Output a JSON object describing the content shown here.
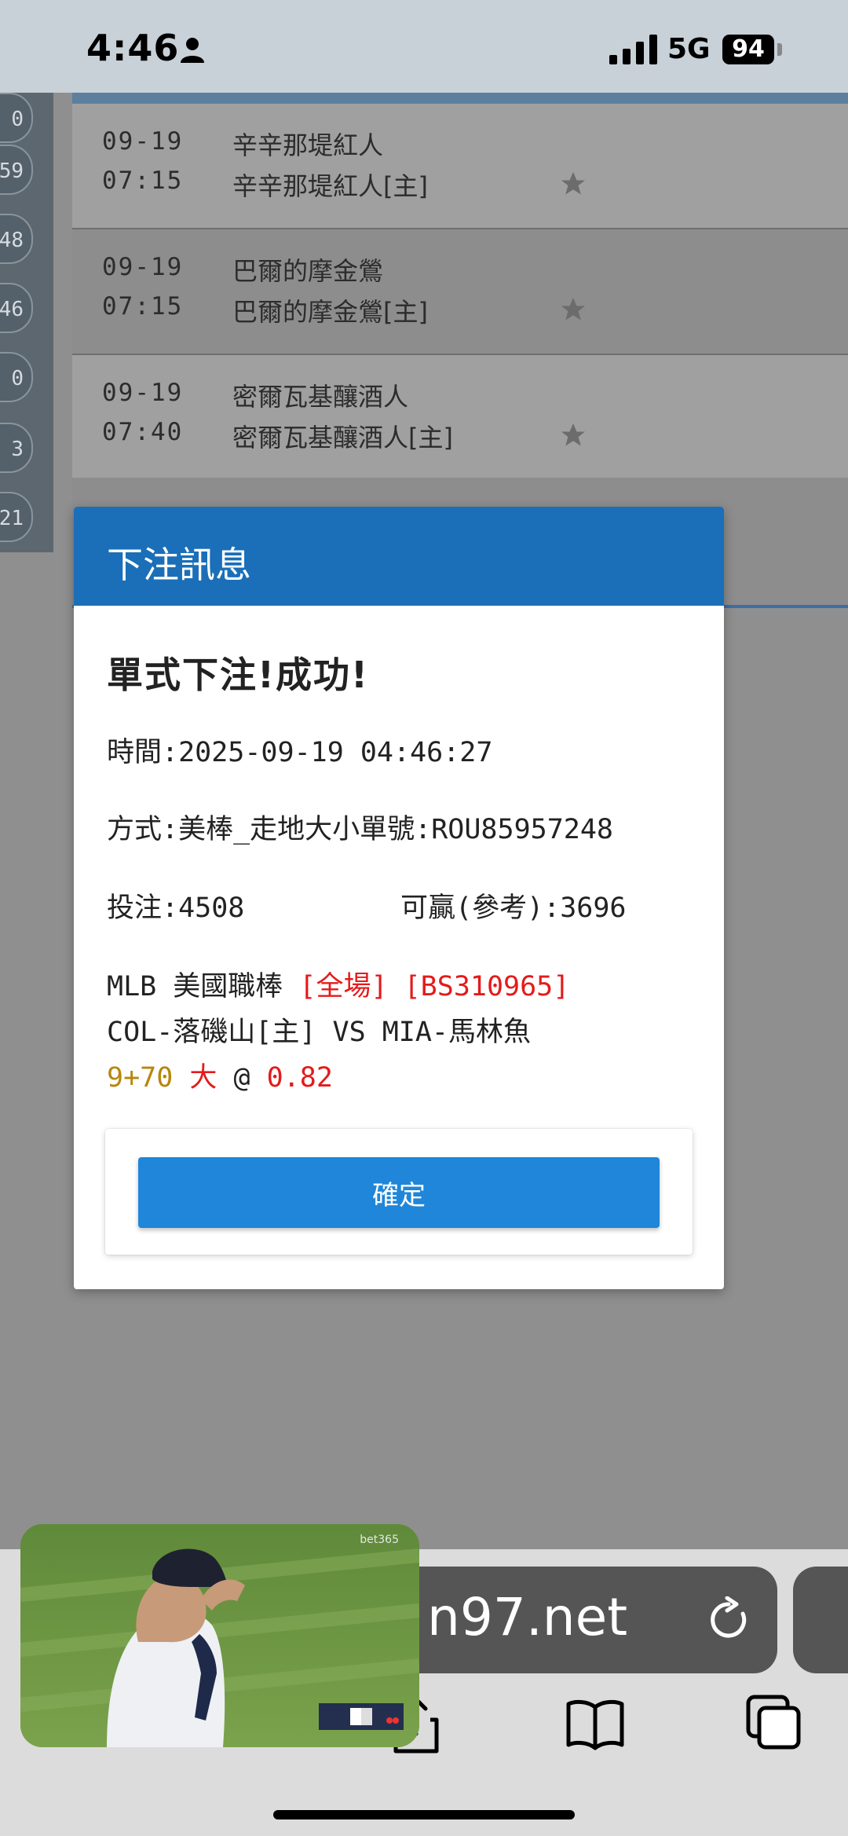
{
  "status_bar": {
    "time": "4:46",
    "network": "5G",
    "battery": "94"
  },
  "left_rail": {
    "tabs": [
      "0",
      "59",
      "48",
      "46",
      "0",
      "3",
      "21"
    ]
  },
  "matches": [
    {
      "date": "09-19",
      "time": "07:15",
      "team": "辛辛那堤紅人",
      "home": "辛辛那堤紅人[主]"
    },
    {
      "date": "09-19",
      "time": "07:15",
      "team": "巴爾的摩金鶯",
      "home": "巴爾的摩金鶯[主]"
    },
    {
      "date": "09-19",
      "time": "07:40",
      "team": "密爾瓦基釀酒人",
      "home": "密爾瓦基釀酒人[主]"
    }
  ],
  "dialog": {
    "title": "下注訊息",
    "result": "單式下注!成功!",
    "time_line": "時間:2025-09-19 04:46:27",
    "method_line": "方式:美棒_走地大小單號:ROU85957248",
    "stake_line": "投注:4508",
    "payout_line": "可贏(參考):3696",
    "league": "MLB 美國職棒",
    "period": "[全場]",
    "bet_code": "[BS310965]",
    "teams": "COL-落磯山[主] VS MIA-馬林魚",
    "line": "9+70",
    "side": "大",
    "at": "@",
    "odds": "0.82",
    "confirm_label": "確定"
  },
  "browser": {
    "url_fragment": "n97.net"
  },
  "pip": {
    "watermark": "bet365"
  },
  "colors": {
    "header_blue": "#1a6fb8",
    "button_blue": "#1f86d9",
    "highlight_red": "#e31b1b",
    "line_gold": "#b8860b"
  }
}
